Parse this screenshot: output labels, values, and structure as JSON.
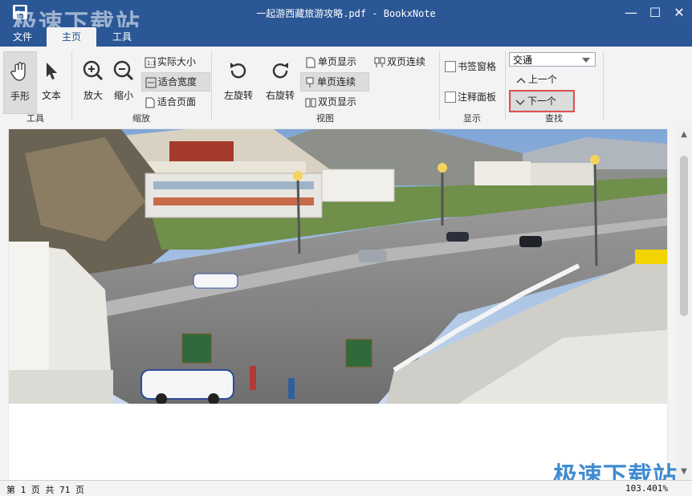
{
  "window": {
    "title": "一起游西藏旅游攻略.pdf - BookxNote",
    "minimize_glyph": "—",
    "maximize_glyph": "☐",
    "close_glyph": "✕"
  },
  "tabs": [
    {
      "label": "文件"
    },
    {
      "label": "主页"
    },
    {
      "label": "工具"
    }
  ],
  "ribbon": {
    "tools": {
      "label": "工具",
      "hand": "手形",
      "text": "文本"
    },
    "zoom": {
      "label": "缩放",
      "zoom_in": "放大",
      "zoom_out": "缩小",
      "actual_size": "实际大小",
      "fit_width": "适合宽度",
      "fit_page": "适合页面"
    },
    "view": {
      "label": "视图",
      "rotate_left": "左旋转",
      "rotate_right": "右旋转",
      "single_page": "单页显示",
      "single_continuous": "单页连续",
      "double_page": "双页显示",
      "double_continuous": "双页连续"
    },
    "display": {
      "label": "显示",
      "bookmark_pane": "书签窗格",
      "annotation_panel": "注释面板"
    },
    "find": {
      "label": "查找",
      "query": "交通",
      "prev": "上一个",
      "next": "下一个"
    }
  },
  "statusbar": {
    "page_info": "第 1 页 共 71 页",
    "zoom": "103.401%"
  },
  "watermarks": {
    "top": "极速下载站",
    "bottom": "极速下载站"
  },
  "colors": {
    "title_bg": "#2b5797",
    "highlight": "#e05050"
  }
}
